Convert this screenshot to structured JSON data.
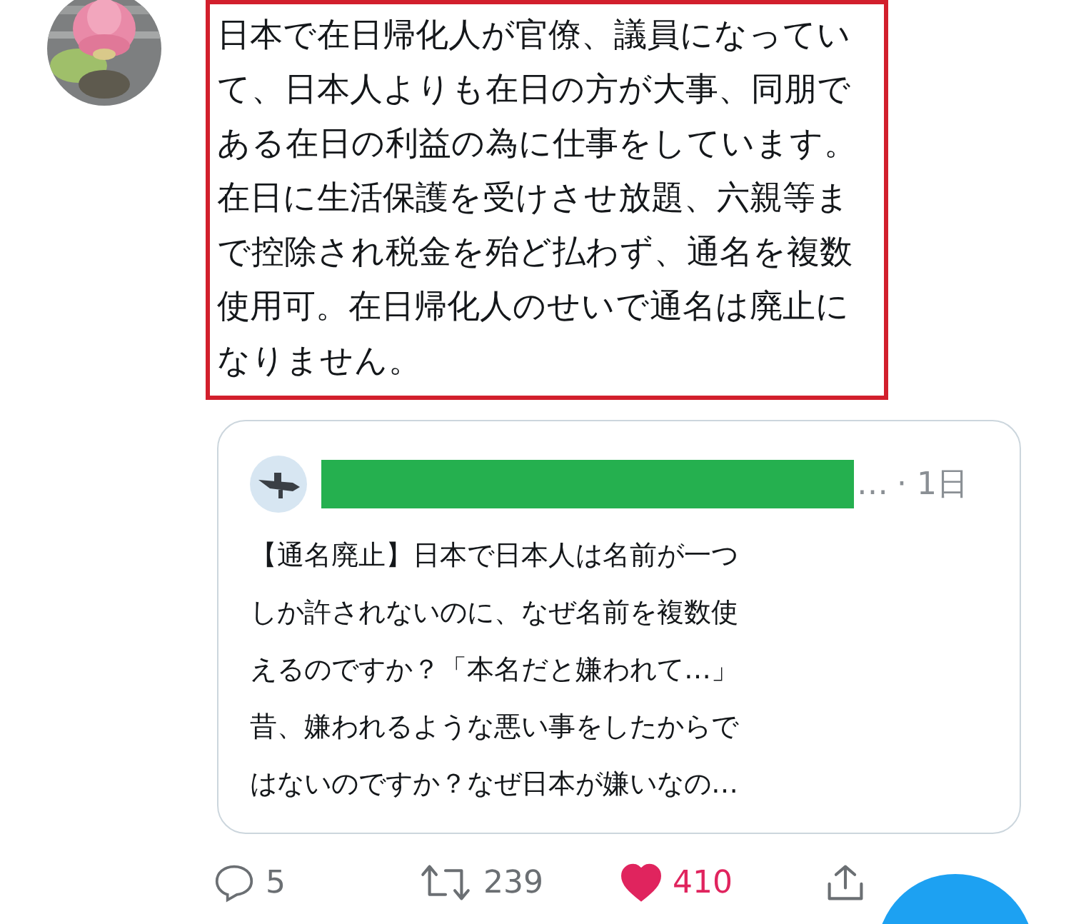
{
  "tweet": {
    "text": "日本で在日帰化人が官僚、議員になっていて、日本人よりも在日の方が大事、同朋である在日の利益の為に仕事をしています。在日に生活保護を受けさせ放題、六親等まで控除され税金を殆ど払わず、通名を複数使用可。在日帰化人のせいで通名は廃止になりません。",
    "highlighted": true
  },
  "quoted_tweet": {
    "name_redacted": true,
    "ellipsis": "…",
    "time": "· 1日",
    "text": "【通名廃止】日本で日本人は名前が一つしか許されないのに、なぜ名前を複数使えるのですか？「本名だと嫌われて…」昔、嫌われるような悪い事をしたからではないのですか？なぜ日本が嫌いなの…"
  },
  "actions": [
    {
      "kind": "reply",
      "count": "5"
    },
    {
      "kind": "retweet",
      "count": "239"
    },
    {
      "kind": "like",
      "count": "410",
      "liked": true
    },
    {
      "kind": "share"
    }
  ],
  "compose_button": {
    "visible": true
  }
}
